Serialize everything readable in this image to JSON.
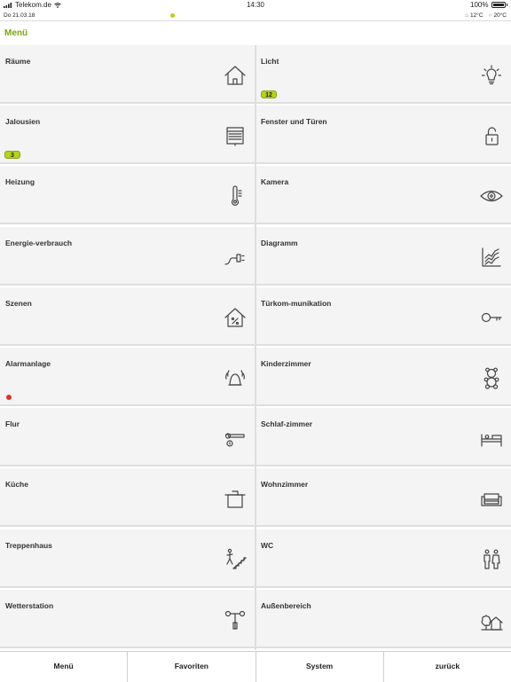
{
  "status": {
    "carrier": "Telekom.de",
    "time": "14:30",
    "battery": "100%"
  },
  "info": {
    "date": "Do 21.03.18",
    "temp_out": "12°C",
    "temp_in": "20°C"
  },
  "page": {
    "title": "Menü"
  },
  "tiles": [
    {
      "label": "Räume",
      "icon": "house-icon"
    },
    {
      "label": "Licht",
      "icon": "lightbulb-icon",
      "badge": "12"
    },
    {
      "label": "Jalousien",
      "icon": "blinds-icon",
      "badge": "3"
    },
    {
      "label": "Fenster und Türen",
      "icon": "padlock-icon"
    },
    {
      "label": "Heizung",
      "icon": "thermometer-icon"
    },
    {
      "label": "Kamera",
      "icon": "eye-icon"
    },
    {
      "label": "Energie-verbrauch",
      "icon": "plug-icon"
    },
    {
      "label": "Diagramm",
      "icon": "chart-icon"
    },
    {
      "label": "Szenen",
      "icon": "house-percent-icon"
    },
    {
      "label": "Türkom-munikation",
      "icon": "key-icon"
    },
    {
      "label": "Alarmanlage",
      "icon": "alarm-bell-icon",
      "alert": true
    },
    {
      "label": "Kinderzimmer",
      "icon": "teddy-bear-icon"
    },
    {
      "label": "Flur",
      "icon": "door-handle-icon"
    },
    {
      "label": "Schlaf-zimmer",
      "icon": "bed-icon"
    },
    {
      "label": "Küche",
      "icon": "cooking-pot-icon"
    },
    {
      "label": "Wohnzimmer",
      "icon": "sofa-icon"
    },
    {
      "label": "Treppenhaus",
      "icon": "stairs-icon"
    },
    {
      "label": "WC",
      "icon": "toilet-people-icon"
    },
    {
      "label": "Wetterstation",
      "icon": "anemometer-icon"
    },
    {
      "label": "Außenbereich",
      "icon": "tree-house-icon"
    }
  ],
  "tabs": [
    "Menü",
    "Favoriten",
    "System",
    "zurück"
  ]
}
